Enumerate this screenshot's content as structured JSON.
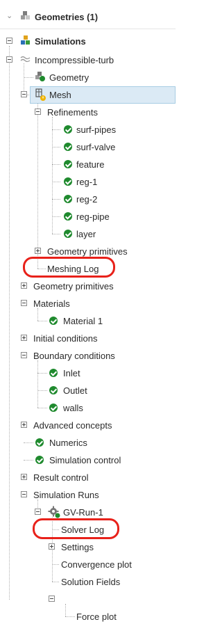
{
  "tree": {
    "geometries": {
      "label": "Geometries (1)"
    },
    "simulations": {
      "label": "Simulations"
    },
    "incompressible": {
      "label": "Incompressible-turb"
    },
    "geometry": {
      "label": "Geometry"
    },
    "mesh": {
      "label": "Mesh"
    },
    "refinements": {
      "label": "Refinements",
      "items": [
        "surf-pipes",
        "surf-valve",
        "feature",
        "reg-1",
        "reg-2",
        "reg-pipe",
        "layer"
      ]
    },
    "mesh_geometry_primitives": {
      "label": "Geometry primitives"
    },
    "meshing_log": {
      "label": "Meshing Log"
    },
    "geometry_primitives": {
      "label": "Geometry primitives"
    },
    "materials": {
      "label": "Materials",
      "items": [
        "Material 1"
      ]
    },
    "initial_conditions": {
      "label": "Initial conditions"
    },
    "boundary_conditions": {
      "label": "Boundary conditions",
      "items": [
        "Inlet",
        "Outlet",
        "walls"
      ]
    },
    "advanced_concepts": {
      "label": "Advanced concepts"
    },
    "numerics": {
      "label": "Numerics"
    },
    "simulation_control": {
      "label": "Simulation control"
    },
    "result_control": {
      "label": "Result control"
    },
    "simulation_runs": {
      "label": "Simulation Runs"
    },
    "run": {
      "label": "GV-Run-1"
    },
    "solver_log": {
      "label": "Solver Log"
    },
    "settings": {
      "label": "Settings"
    },
    "convergence_plot": {
      "label": "Convergence plot"
    },
    "solution_fields": {
      "label": "Solution Fields"
    },
    "force_plot": {
      "label": "Force plot"
    }
  },
  "colors": {
    "check": "#1f8a2e",
    "selection": "#dbeaf5",
    "highlight": "#e8211a"
  },
  "icons": {
    "status": "check-circle-icon",
    "geometry": "geometry-cubes-icon",
    "simulation": "simulation-icon",
    "flow": "flow-waves-icon",
    "mesh": "mesh-warning-icon",
    "run": "gear-run-icon"
  }
}
